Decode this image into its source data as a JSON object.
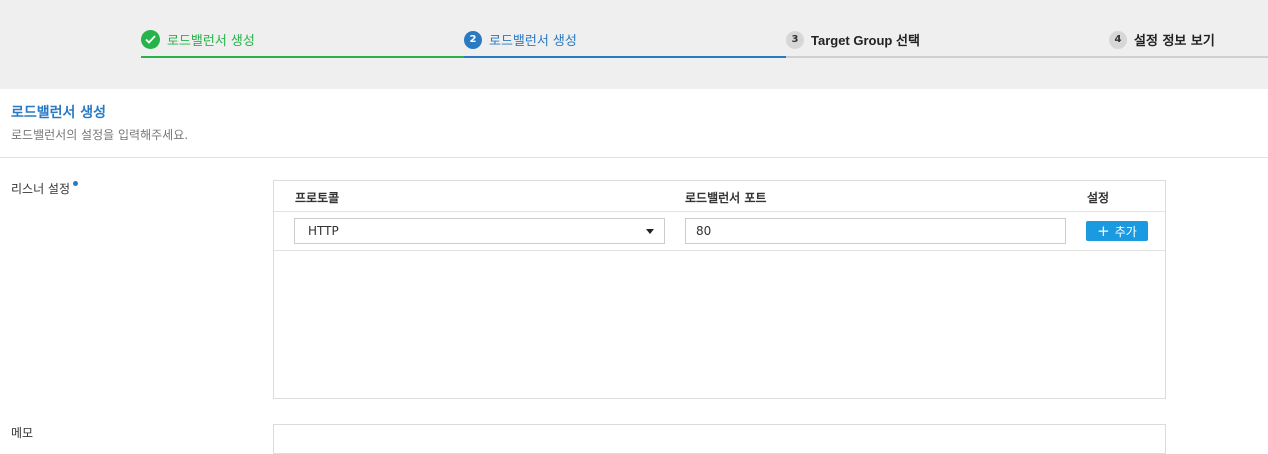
{
  "stepper": {
    "steps": [
      {
        "num": "✓",
        "label": "로드밸런서 생성",
        "state": "completed"
      },
      {
        "num": "2",
        "label": "로드밸런서 생성",
        "state": "active"
      },
      {
        "num": "3",
        "label": "Target Group 선택",
        "state": "pending"
      },
      {
        "num": "4",
        "label": "설정 정보 보기",
        "state": "pending"
      }
    ],
    "colors": {
      "completed": "#26b34a",
      "active": "#2a7ac2",
      "pending": "#d7d7d7"
    }
  },
  "page": {
    "title": "로드밸런서 생성",
    "description": "로드밸런서의 설정을 입력해주세요."
  },
  "listener": {
    "label": "리스너 설정",
    "columns": {
      "protocol": "프로토콜",
      "port": "로드밸런서 포트",
      "settings": "설정"
    },
    "row": {
      "protocol": "HTTP",
      "port": "80"
    },
    "add_label": "추가"
  },
  "memo": {
    "label": "메모"
  }
}
